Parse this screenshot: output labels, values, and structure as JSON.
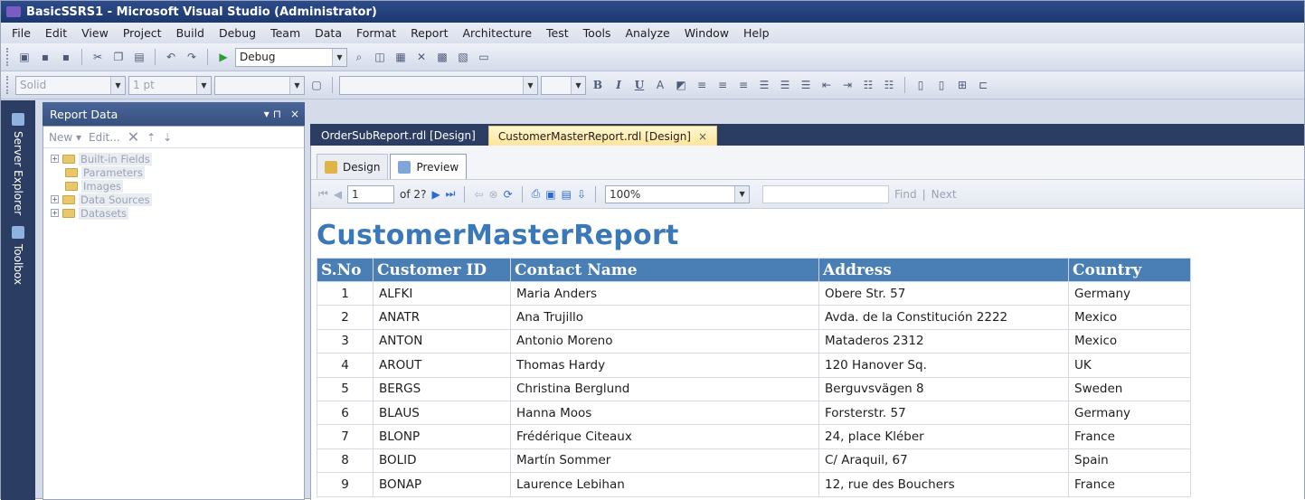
{
  "window": {
    "title": "BasicSSRS1 - Microsoft Visual Studio (Administrator)"
  },
  "menu": [
    "File",
    "Edit",
    "View",
    "Project",
    "Build",
    "Debug",
    "Team",
    "Data",
    "Format",
    "Report",
    "Architecture",
    "Test",
    "Tools",
    "Analyze",
    "Window",
    "Help"
  ],
  "toolbar1": {
    "config": "Debug"
  },
  "toolbar2": {
    "border_style": "Solid",
    "border_width": "1 pt",
    "bold": "B",
    "italic": "I",
    "underline": "U"
  },
  "side_tabs": {
    "server_explorer": "Server Explorer",
    "toolbox": "Toolbox"
  },
  "report_data": {
    "title": "Report Data",
    "pin": "▾ ⊓",
    "close": "×",
    "new_label": "New ▾",
    "edit_label": "Edit...",
    "tree": [
      {
        "label": "Built-in Fields",
        "expandable": true
      },
      {
        "label": "Parameters",
        "expandable": false
      },
      {
        "label": "Images",
        "expandable": false
      },
      {
        "label": "Data Sources",
        "expandable": true
      },
      {
        "label": "Datasets",
        "expandable": true
      }
    ]
  },
  "doc_tabs": [
    {
      "label": "OrderSubReport.rdl [Design]"
    },
    {
      "label": "CustomerMasterReport.rdl [Design]",
      "close": "×"
    }
  ],
  "view_tabs": {
    "design": "Design",
    "preview": "Preview"
  },
  "preview_toolbar": {
    "page": "1",
    "of": "of 2?",
    "zoom": "100%",
    "find": "Find",
    "next": "Next",
    "sep": "|"
  },
  "report": {
    "title": "CustomerMasterReport",
    "columns": [
      "S.No",
      "Customer ID",
      "Contact Name",
      "Address",
      "Country"
    ],
    "rows": [
      [
        "1",
        "ALFKI",
        "Maria Anders",
        "Obere Str. 57",
        "Germany"
      ],
      [
        "2",
        "ANATR",
        "Ana Trujillo",
        "Avda. de la Constitución 2222",
        "Mexico"
      ],
      [
        "3",
        "ANTON",
        "Antonio Moreno",
        "Mataderos  2312",
        "Mexico"
      ],
      [
        "4",
        "AROUT",
        "Thomas Hardy",
        "120 Hanover Sq.",
        "UK"
      ],
      [
        "5",
        "BERGS",
        "Christina Berglund",
        "Berguvsvägen  8",
        "Sweden"
      ],
      [
        "6",
        "BLAUS",
        "Hanna Moos",
        "Forsterstr. 57",
        "Germany"
      ],
      [
        "7",
        "BLONP",
        "Frédérique Citeaux",
        "24, place Kléber",
        "France"
      ],
      [
        "8",
        "BOLID",
        "Martín Sommer",
        "C/ Araquil, 67",
        "Spain"
      ],
      [
        "9",
        "BONAP",
        "Laurence Lebihan",
        "12, rue des Bouchers",
        "France"
      ]
    ]
  },
  "colors": {
    "title_bar": "#1c3870",
    "report_header": "#4a7fb5",
    "report_title": "#3b78b8",
    "active_tab": "#ffe59a"
  }
}
